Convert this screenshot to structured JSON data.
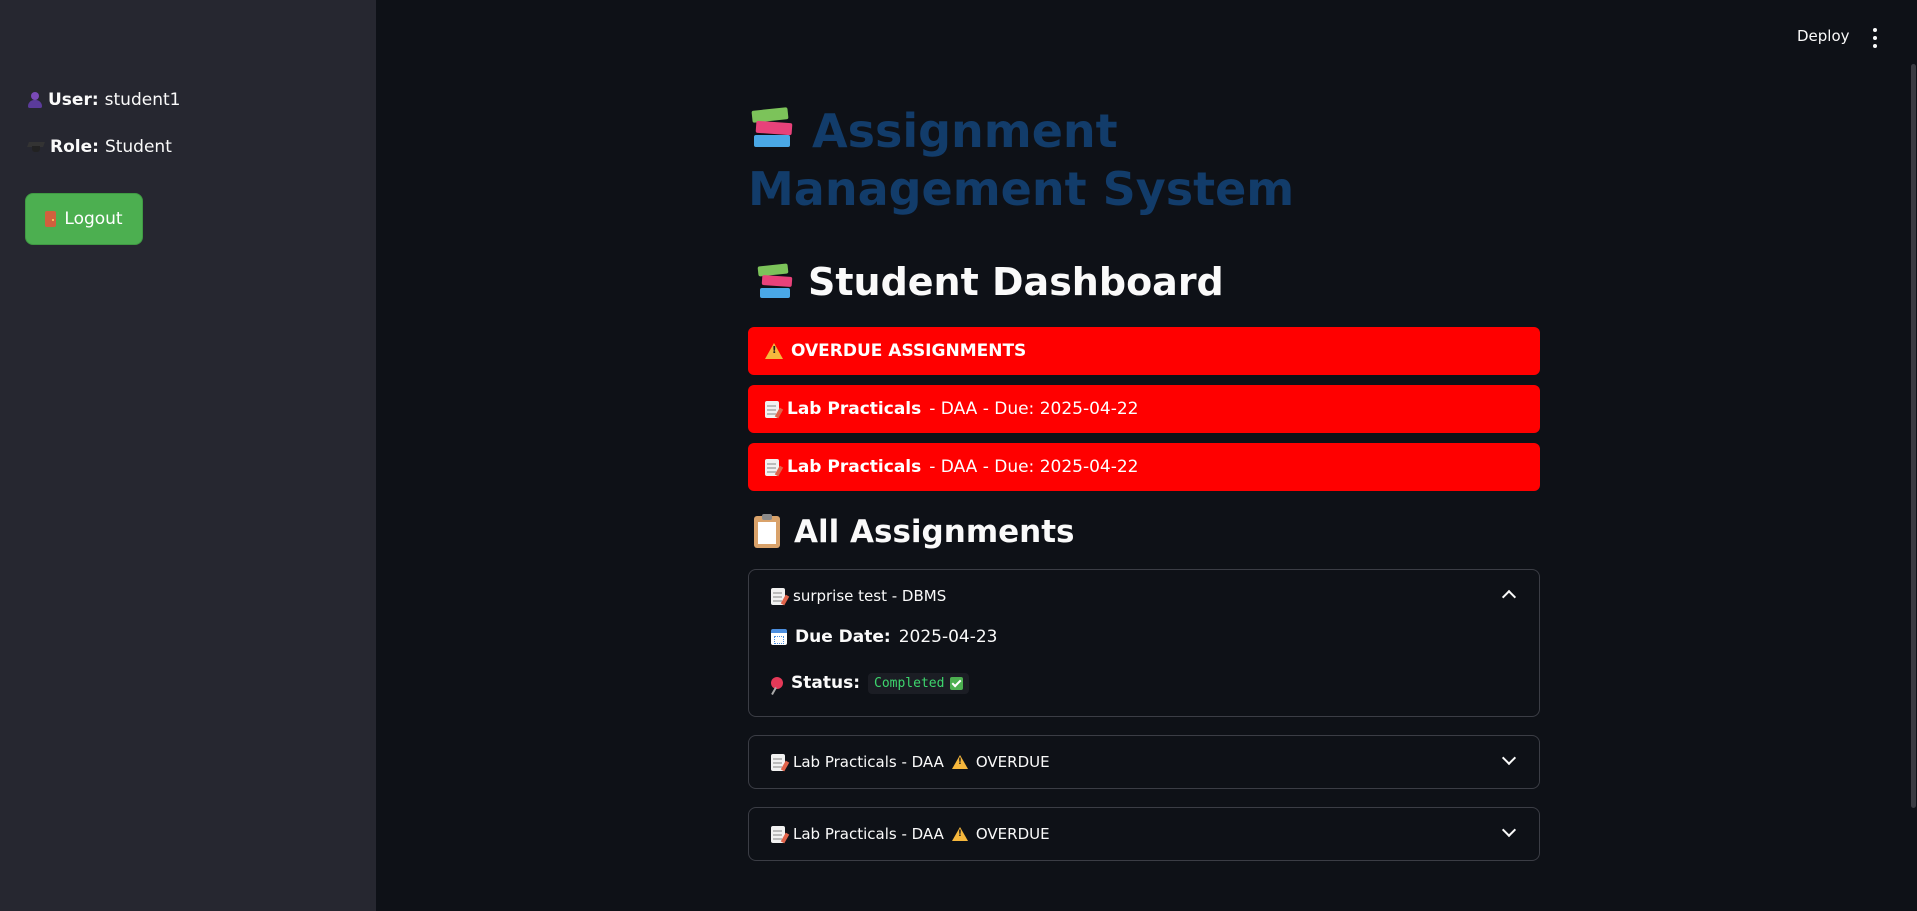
{
  "sidebar": {
    "user_label": "User:",
    "user_value": "student1",
    "role_label": "Role:",
    "role_value": "Student",
    "logout_label": "Logout"
  },
  "topbar": {
    "deploy_label": "Deploy"
  },
  "main": {
    "app_title": "Assignment Management System",
    "dashboard_title": "Student Dashboard",
    "overdue_header": "OVERDUE ASSIGNMENTS",
    "overdue_items": [
      {
        "title": "Lab Practicals",
        "detail": "- DAA - Due: 2025-04-22"
      },
      {
        "title": "Lab Practicals",
        "detail": "- DAA - Due: 2025-04-22"
      }
    ],
    "all_title": "All Assignments",
    "assignments": [
      {
        "label": "surprise test - DBMS",
        "suffix": "",
        "expanded": true,
        "due_label": "Due Date:",
        "due_value": "2025-04-23",
        "status_label": "Status:",
        "status_value": "Completed"
      },
      {
        "label": "Lab Practicals - DAA",
        "suffix": "OVERDUE",
        "expanded": false
      },
      {
        "label": "Lab Practicals - DAA",
        "suffix": "OVERDUE",
        "expanded": false
      }
    ]
  },
  "colors": {
    "background": "#0e1117",
    "sidebar": "#262730",
    "logout_button": "#4caf50",
    "alert_red": "#ff0000",
    "app_title": "#123c6a"
  }
}
